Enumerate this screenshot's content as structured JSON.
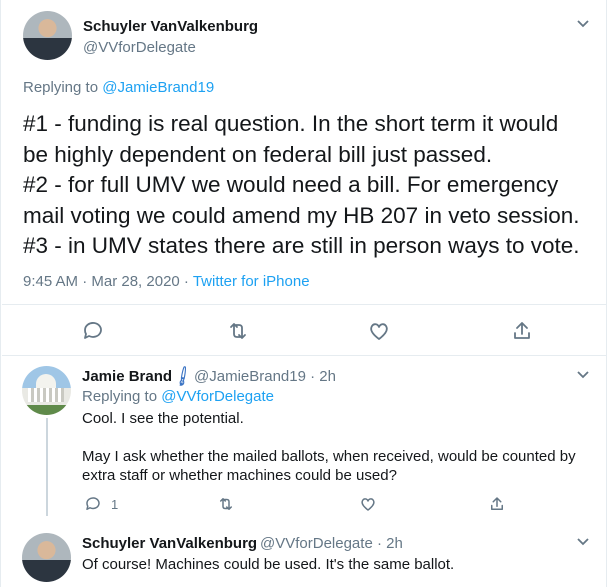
{
  "tweet": {
    "name": "Schuyler VanValkenburg",
    "handle": "@VVforDelegate",
    "replying_prefix": "Replying to",
    "replying_to": "@JamieBrand19",
    "lines": [
      "#1 - funding is real question. In the short term it would",
      "be highly dependent on federal bill just passed.",
      "#2 - for full UMV we would need a bill. For emergency",
      "mail voting we could amend my HB 207 in veto session.",
      "#3 - in UMV states there are still in person ways to vote."
    ],
    "timestamp": "9:45 AM · Mar 28, 2020 · ",
    "source": "Twitter for iPhone"
  },
  "reply1": {
    "name": "Jamie Brand",
    "handle_time": "@JamieBrand19 · 2h",
    "replying_prefix": "Replying to",
    "replying_to": "@VVforDelegate",
    "line1": "Cool. I see the potential.",
    "line2": "May I ask whether the mailed ballots, when received, would be counted by",
    "line3": "extra staff or whether machines could be used?",
    "reply_count": "1"
  },
  "reply2": {
    "name": "Schuyler VanValkenburg",
    "handle_time": "@VVforDelegate · 2h",
    "text": "Of course! Machines could be used. It's the same ballot."
  },
  "colors": {
    "accent": "#1da1f2",
    "muted": "#657786",
    "border": "#e6ecf0"
  },
  "icons": [
    "reply-icon",
    "retweet-icon",
    "like-icon",
    "share-icon",
    "chevron-down-icon",
    "paintbrush-emoji"
  ]
}
